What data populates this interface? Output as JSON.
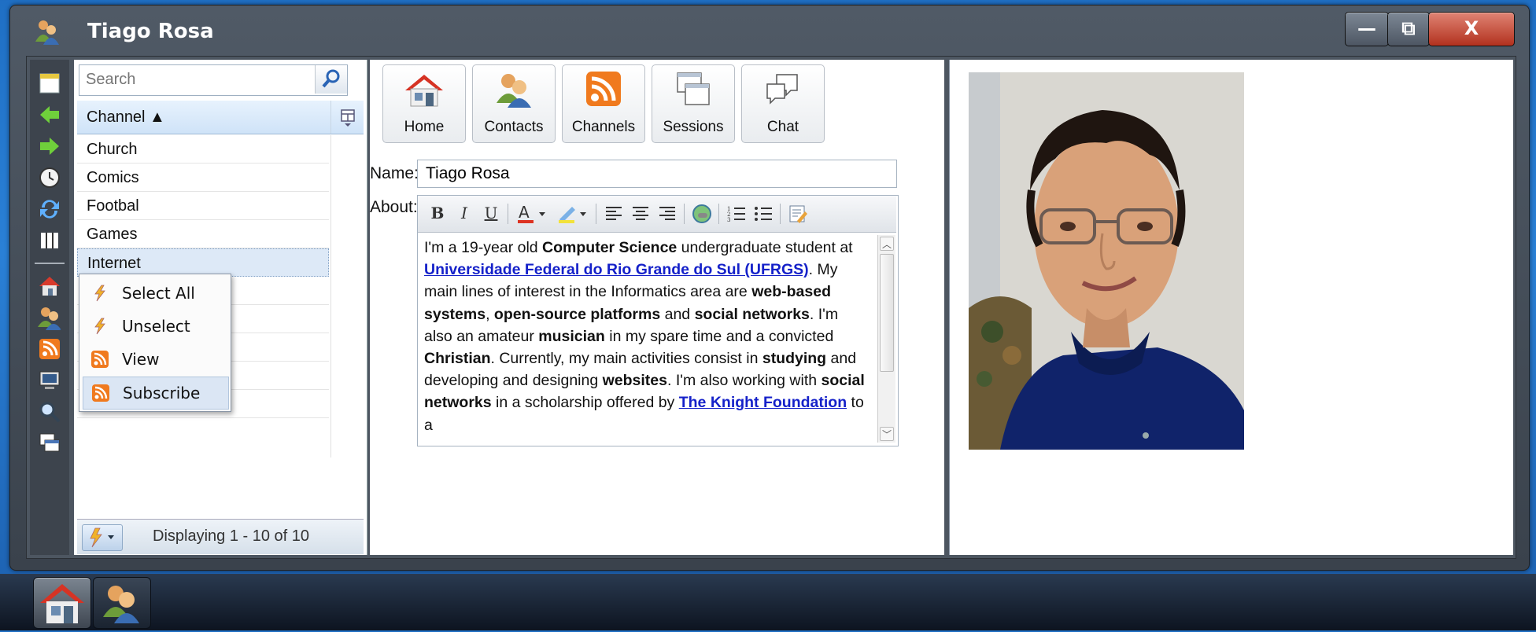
{
  "window": {
    "title": "Tiago Rosa",
    "controls": {
      "minimize": "—",
      "maximize": "⧉",
      "close": "X"
    }
  },
  "left_toolbar": {
    "icons": [
      "new-note-icon",
      "back-arrow-icon",
      "forward-arrow-icon",
      "clock-icon",
      "refresh-icon",
      "columns-icon",
      "home-icon",
      "contacts-icon",
      "rss-icon",
      "computer-icon",
      "search-icon",
      "windows-icon"
    ]
  },
  "list": {
    "search_placeholder": "Search",
    "column_header": "Channel ▲",
    "rows": [
      "Church",
      "Comics",
      "Footbal",
      "Games",
      "Internet"
    ],
    "selected": "Internet",
    "pagination": "Displaying 1 - 10 of 10"
  },
  "context_menu": {
    "items": [
      {
        "label": "Select All",
        "icon": "lightning-icon"
      },
      {
        "label": "Unselect",
        "icon": "lightning-icon"
      },
      {
        "label": "View",
        "icon": "rss-icon"
      },
      {
        "label": "Subscribe",
        "icon": "rss-icon",
        "highlighted": true
      }
    ]
  },
  "nav_buttons": [
    {
      "label": "Home",
      "icon": "home-icon"
    },
    {
      "label": "Contacts",
      "icon": "contacts-icon"
    },
    {
      "label": "Channels",
      "icon": "rss-icon"
    },
    {
      "label": "Sessions",
      "icon": "sessions-icon"
    },
    {
      "label": "Chat",
      "icon": "chat-icon"
    }
  ],
  "profile": {
    "name_label": "Name:",
    "name_value": "Tiago Rosa",
    "about_label": "About:",
    "about_text": [
      {
        "t": "I'm a 19-year old "
      },
      {
        "t": "Computer Science",
        "b": true
      },
      {
        "t": " undergraduate student at "
      },
      {
        "t": "Universidade Federal do Rio Grande do Sul (UFRGS)",
        "a": true
      },
      {
        "t": ". My main lines of interest in the Informatics area are "
      },
      {
        "t": "web-based systems",
        "b": true
      },
      {
        "t": ", "
      },
      {
        "t": "open-source platforms",
        "b": true
      },
      {
        "t": " and "
      },
      {
        "t": "social networks",
        "b": true
      },
      {
        "t": ". I'm also an amateur "
      },
      {
        "t": "musician",
        "b": true
      },
      {
        "t": " in my spare time and a convicted "
      },
      {
        "t": "Christian",
        "b": true
      },
      {
        "t": ". Currently, my main activities consist in "
      },
      {
        "t": "studying",
        "b": true
      },
      {
        "t": " and developing and designing "
      },
      {
        "t": "websites",
        "b": true
      },
      {
        "t": ". I'm also working with "
      },
      {
        "t": "social networks",
        "b": true
      },
      {
        "t": " in a scholarship offered by "
      },
      {
        "t": "The Knight Foundation",
        "a": true
      },
      {
        "t": " to a"
      }
    ]
  },
  "editor_toolbar": [
    "B",
    "I",
    "U"
  ],
  "taskbar": {
    "items": [
      "home-icon",
      "contacts-icon"
    ]
  },
  "colors": {
    "accent": "#1521c9",
    "selection": "#dde9f7",
    "rss": "#f07a1e"
  }
}
